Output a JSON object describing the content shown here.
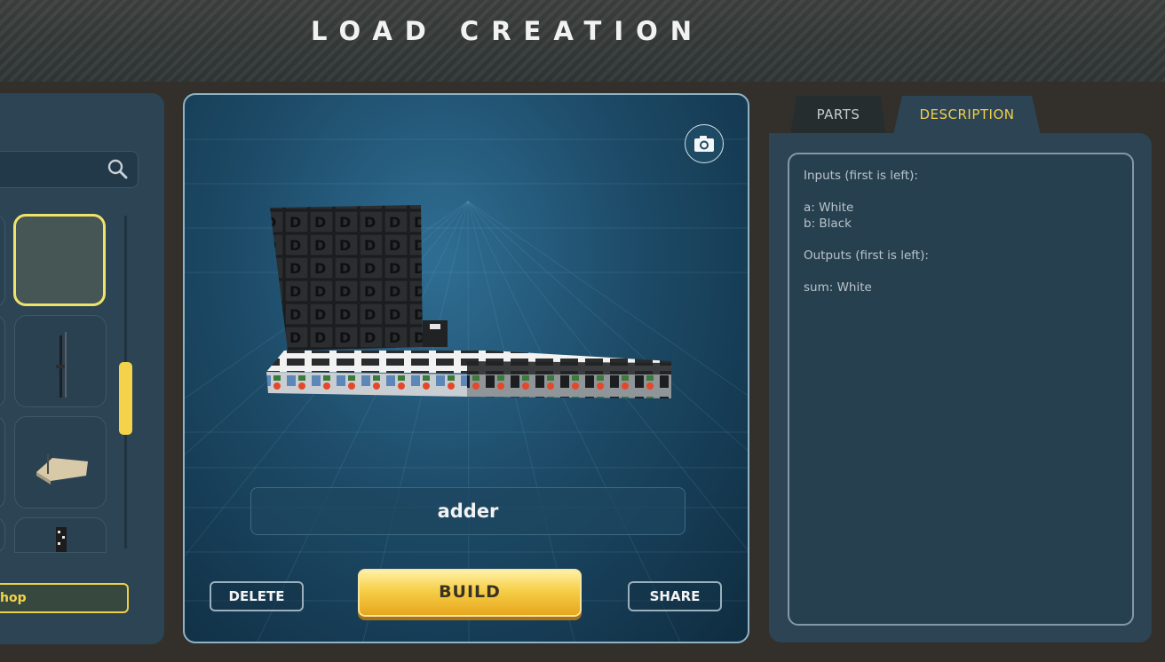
{
  "header": {
    "title": "LOAD CREATION"
  },
  "sidebar": {
    "shop_label": "hop",
    "scrollbar_position": 0.44
  },
  "viewer": {
    "creation_name": "adder",
    "delete_label": "DELETE",
    "build_label": "BUILD",
    "share_label": "SHARE"
  },
  "tabs": [
    {
      "label": "PARTS",
      "active": false
    },
    {
      "label": "DESCRIPTION",
      "active": true
    }
  ],
  "description": {
    "lines": [
      "Inputs (first is left):",
      "a: White",
      "b: Black",
      "Outputs (first is left):",
      "sum: White"
    ]
  },
  "colors": {
    "accent": "#f3cf4a",
    "panel": "#2c4453"
  }
}
